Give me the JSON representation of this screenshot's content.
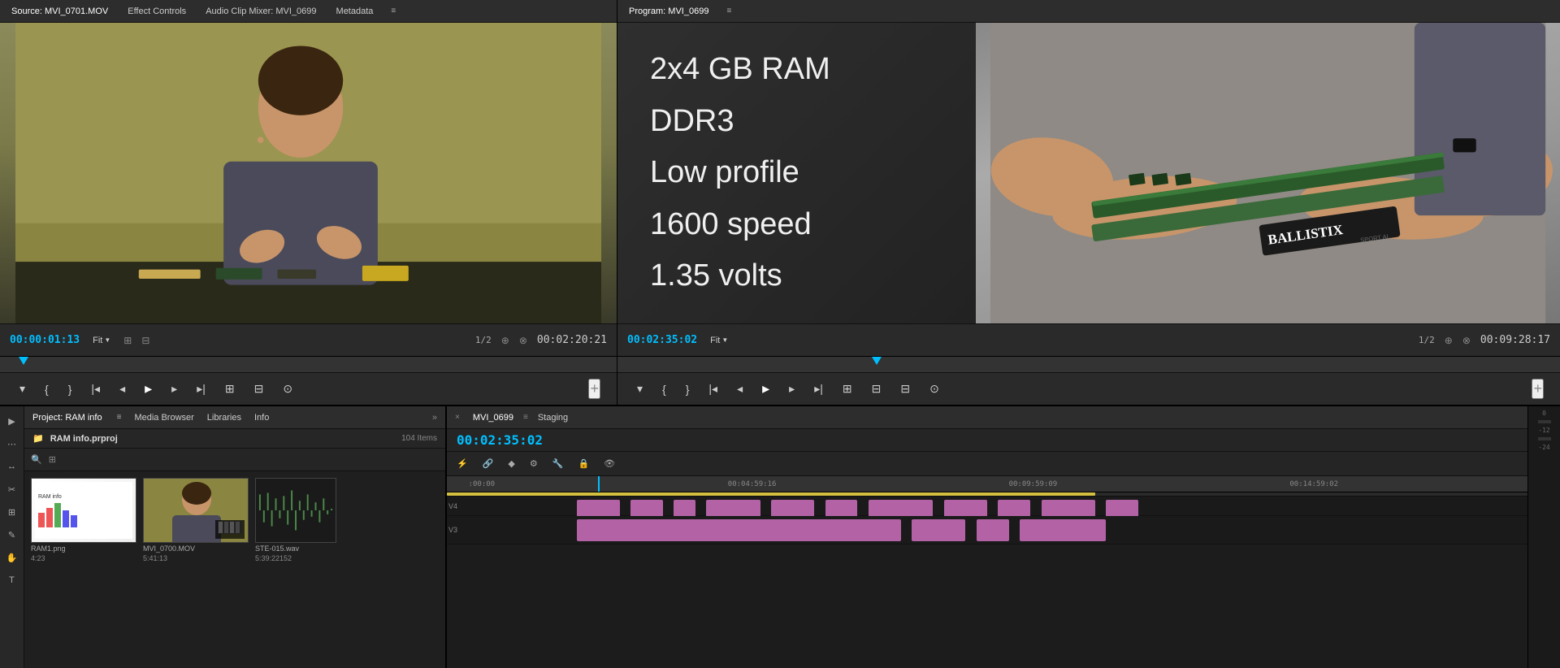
{
  "source_panel": {
    "title": "Source: MVI_0701.MOV",
    "tabs": [
      "Source: MVI_0701.MOV",
      "Effect Controls",
      "Audio Clip Mixer: MVI_0699",
      "Metadata"
    ],
    "timecode": "00:00:01:13",
    "fit": "Fit",
    "fraction": "1/2",
    "total_time": "00:02:20:21",
    "menu_icon": "≡"
  },
  "program_panel": {
    "title": "Program: MVI_0699",
    "timecode": "00:02:35:02",
    "fit": "Fit",
    "fraction": "1/2",
    "total_time": "00:09:28:17",
    "menu_icon": "≡",
    "overlay_lines": [
      "2x4 GB RAM",
      "DDR3",
      "Low profile",
      "1600 speed",
      "1.35 volts"
    ]
  },
  "project_panel": {
    "title": "Project: RAM info",
    "tabs": [
      "Project: RAM info",
      "Media Browser",
      "Libraries",
      "Info"
    ],
    "item_count": "104 Items",
    "project_file": "RAM info.prproj",
    "menu_icon": "≡",
    "expand_icon": "»",
    "items": [
      {
        "name": "RAM1.png",
        "duration": "4:23",
        "type": "image"
      },
      {
        "name": "MVI_0700.MOV",
        "duration": "5:41:13",
        "type": "video"
      },
      {
        "name": "STE-015.wav",
        "duration": "5:39:22152",
        "type": "audio"
      }
    ]
  },
  "timeline_panel": {
    "tabs": [
      "MVI_0699",
      "Staging"
    ],
    "close_icon": "×",
    "menu_icon": "≡",
    "timecode": "00:02:35:02",
    "ruler_times": [
      ":00:00",
      "00:04:59:16",
      "00:09:59:09",
      "00:14:59:02"
    ],
    "tracks": {
      "v4_label": "V4",
      "v3_label": "V3"
    }
  },
  "transport": {
    "source": {
      "buttons": [
        "◂◂",
        "◂",
        "▸",
        "▸▸",
        "▸|"
      ]
    },
    "program": {
      "buttons": [
        "◂◂",
        "◂",
        "▸",
        "▸▸",
        "▸|"
      ]
    }
  },
  "icons": {
    "settings": "⚙",
    "search": "🔍",
    "folder": "📁",
    "wrench": "🔧",
    "scissors": "✂",
    "arrow_left": "←",
    "arrow_right": "→"
  }
}
